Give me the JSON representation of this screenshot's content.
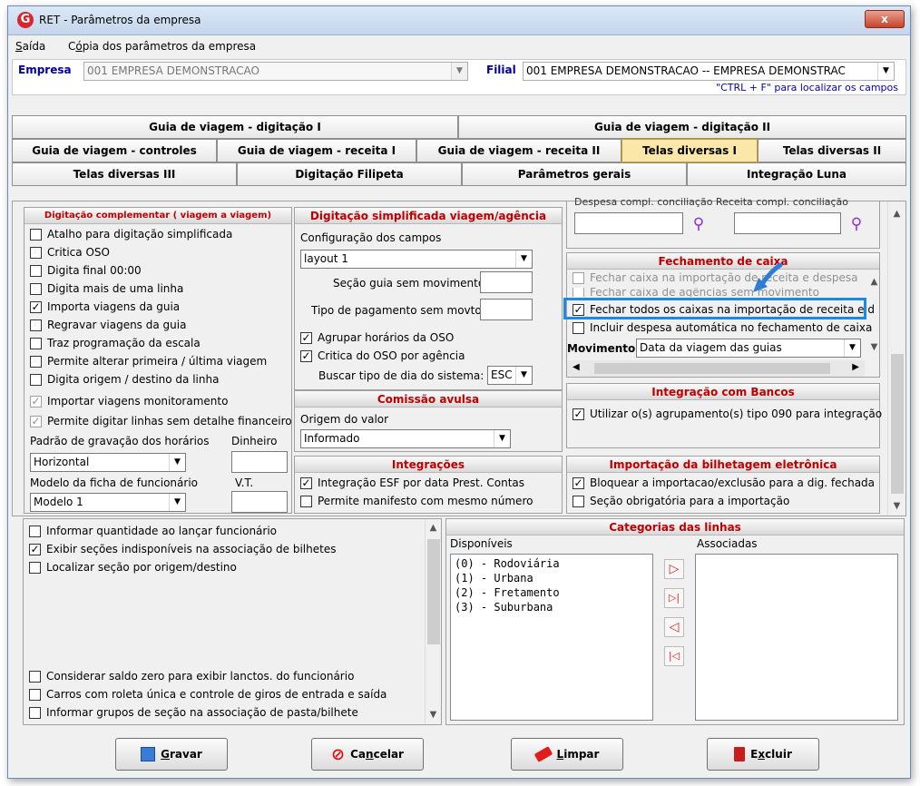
{
  "window": {
    "title": "RET - Parâmetros da empresa",
    "close": "x",
    "app_icon": "G"
  },
  "menu": [
    {
      "pre": "",
      "acc": "S",
      "post": "aída"
    },
    {
      "pre": "C",
      "acc": "ó",
      "post": "pia dos parâmetros da empresa"
    }
  ],
  "empresa": {
    "label": "Empresa",
    "value": "001 EMPRESA DEMONSTRACAO"
  },
  "filial": {
    "label": "Filial",
    "value": "001 EMPRESA DEMONSTRACAO -- EMPRESA DEMONSTRAC"
  },
  "hint": "\"CTRL + F\" para localizar os campos",
  "tabs": {
    "row1": [
      "Guia de viagem - digitação I",
      "Guia de viagem - digitação II"
    ],
    "row2": [
      "Guia de viagem - controles",
      "Guia de viagem - receita I",
      "Guia de viagem - receita II",
      "Telas diversas I",
      "Telas diversas II"
    ],
    "row3": [
      "Telas diversas III",
      "Digitação Filipeta",
      "Parâmetros gerais",
      "Integração Luna"
    ],
    "active": "Telas diversas I"
  },
  "digitacao_complementar": {
    "title": "Digitação complementar ( viagem a viagem)",
    "items": [
      {
        "label": "Atalho para digitação simplificada",
        "checked": false
      },
      {
        "label": "Critica OSO",
        "checked": false
      },
      {
        "label": "Digita final 00:00",
        "checked": false
      },
      {
        "label": "Digita mais de uma linha",
        "checked": false
      },
      {
        "label": "Importa viagens da guia",
        "checked": true
      },
      {
        "label": "Regravar viagens da guia",
        "checked": false
      },
      {
        "label": "Traz programação da escala",
        "checked": false
      },
      {
        "label": "Permite alterar primeira / última viagem",
        "checked": false
      },
      {
        "label": "Digita origem / destino da linha",
        "checked": false
      },
      {
        "label": "Importar viagens monitoramento",
        "checked": true,
        "disabled": true
      },
      {
        "label": "Permite digitar linhas sem detalhe financeiro",
        "checked": true,
        "disabled": true
      }
    ],
    "padrao_label": "Padrão de gravação dos horários",
    "padrao_value": "Horizontal",
    "dinheiro_label": "Dinheiro",
    "modelo_label": "Modelo da ficha de funcionário",
    "modelo_value": "Modelo 1",
    "vt_label": "V.T."
  },
  "digitacao_simplificada": {
    "title": "Digitação simplificada viagem/agência",
    "config_label": "Configuração dos campos",
    "config_value": "layout 1",
    "secao_label": "Seção guia sem movimento",
    "tipo_pag_label": "Tipo de pagamento sem movto",
    "agrupar": {
      "label": "Agrupar horários da OSO",
      "checked": true
    },
    "critica": {
      "label": "Critica do OSO por agência",
      "checked": true
    },
    "buscar_label": "Buscar tipo de dia do sistema:",
    "buscar_value": "ESC"
  },
  "comissao": {
    "title": "Comissão avulsa",
    "origem_label": "Origem do valor",
    "origem_value": "Informado"
  },
  "integracoes": {
    "title": "Integrações",
    "items": [
      {
        "label": "Integração ESF por data Prest. Contas",
        "checked": true
      },
      {
        "label": "Permite manifesto com mesmo número",
        "checked": false
      }
    ]
  },
  "right_top": {
    "cut_labels": "Despesa compl. conciliação    Receita compl. conciliação"
  },
  "fechamento": {
    "title": "Fechamento de caixa",
    "items": [
      {
        "label": "Fechar caixa na importação de receita e despesa",
        "checked": false,
        "disabled": true
      },
      {
        "label": "Fechar caixa de agências sem movimento",
        "checked": false,
        "disabled": true
      },
      {
        "label": "Fechar todos os caixas na importação de receita e d",
        "checked": true
      },
      {
        "label": "Incluir despesa automática no fechamento de caixa",
        "checked": false
      }
    ],
    "movimento_label": "Movimento",
    "movimento_value": "Data da viagem das guias"
  },
  "bancos": {
    "title": "Integração com Bancos",
    "items": [
      {
        "label": "Utilizar o(s) agrupamento(s) tipo 090 para integração",
        "checked": true
      }
    ]
  },
  "bilhetagem": {
    "title": "Importação da bilhetagem eletrônica",
    "items": [
      {
        "label": "Bloquear a importacao/exclusão para a dig. fechada",
        "checked": true
      },
      {
        "label": "Seção obrigatória para a importação",
        "checked": false
      }
    ]
  },
  "bottom_left": {
    "items_top": [
      {
        "label": "Informar quantidade ao lançar funcionário",
        "checked": false
      },
      {
        "label": "Exibir seções indisponíveis na associação de bilhetes",
        "checked": true
      },
      {
        "label": "Localizar seção por origem/destino",
        "checked": false
      }
    ],
    "items_bottom": [
      {
        "label": "Considerar saldo zero para exibir lanctos. do funcionário",
        "checked": false
      },
      {
        "label": "Carros com roleta única e controle de giros de entrada e saída",
        "checked": false
      },
      {
        "label": "Informar grupos de seção na associação de pasta/bilhete",
        "checked": false
      }
    ]
  },
  "categorias": {
    "title": "Categorias das linhas",
    "disponiveis_label": "Disponíveis",
    "associadas_label": "Associadas",
    "disponiveis": [
      "(0) - Rodoviária",
      "(1) - Urbana",
      "(2) - Fretamento",
      "(3) - Suburbana"
    ],
    "associadas": []
  },
  "buttons": [
    {
      "pre": "",
      "acc": "G",
      "post": "ravar",
      "icon": "save-icon"
    },
    {
      "pre": "Ca",
      "acc": "n",
      "post": "celar",
      "icon": "cancel-icon"
    },
    {
      "pre": "",
      "acc": "L",
      "post": "impar",
      "icon": "eraser-icon"
    },
    {
      "pre": "E",
      "acc": "x",
      "post": "cluir",
      "icon": "trash-icon"
    }
  ],
  "colors": {
    "header_red": "#c00000",
    "accent_blue": "#0000a0",
    "highlight": "#1e88e5",
    "active_tab": "#fbe8a8"
  }
}
